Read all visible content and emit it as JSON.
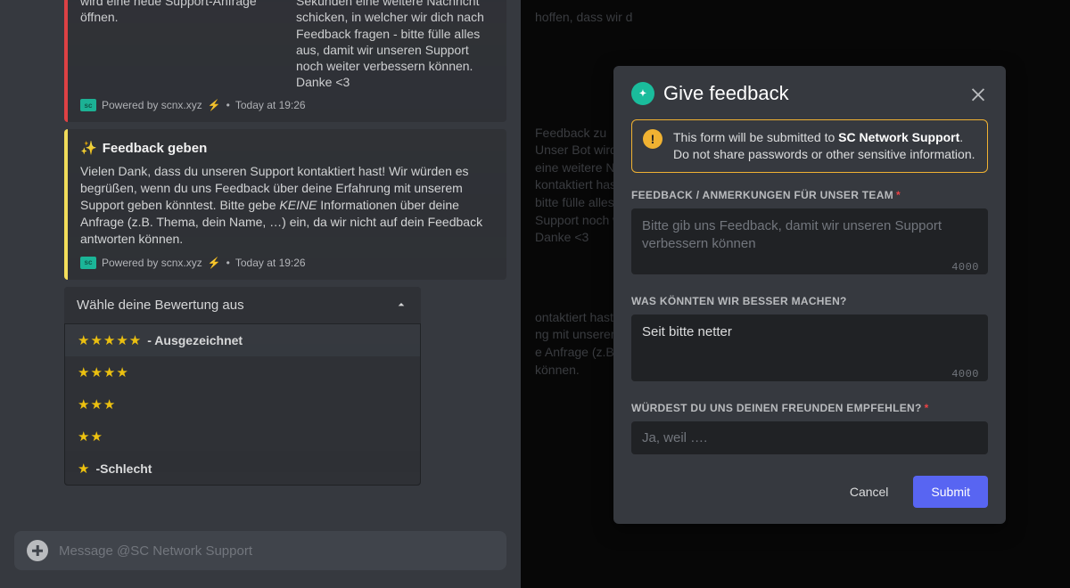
{
  "leftChat": {
    "embed1": {
      "colLeft": "Eine Antwort auf diese Nachricht wird eine neue Support-Anfrage öffnen.",
      "colRight": "Unser Bot wird dir in wenigen Sekunden eine weitere Nachricht schicken, in welcher wir dich nach Feedback fragen - bitte fülle alles aus, damit wir unseren Support noch weiter verbessern können. Danke <3",
      "footer_powered": "Powered by scnx.xyz",
      "footer_time": "Today at 19:26"
    },
    "embed2": {
      "title": "Feedback geben",
      "body_pre": "Vielen Dank, dass du unseren Support kontaktiert hast! Wir würden es begrüßen, wenn du uns Feedback über deine Erfahrung mit unserem Support geben könntest. Bitte gebe ",
      "body_em": "KEINE",
      "body_post": " Informationen über deine Anfrage (z.B. Thema, dein Name, …) ein, da wir nicht auf dein Feedback antworten können.",
      "footer_powered": "Powered by scnx.xyz",
      "footer_time": "Today at 19:26"
    },
    "dropdown": {
      "header": "Wähle deine Bewertung aus",
      "options": [
        {
          "stars": "★★★★★",
          "label": " - Ausgezeichnet"
        },
        {
          "stars": "★★★★",
          "label": ""
        },
        {
          "stars": "★★★",
          "label": ""
        },
        {
          "stars": "★★",
          "label": ""
        },
        {
          "stars": "★",
          "label": " -Schlecht"
        }
      ]
    },
    "messageInput": {
      "placeholder": "Message @SC Network Support"
    }
  },
  "rightGhost": {
    "line1": "hoffen, dass wir d",
    "block1": "Feedback zu\nUnser Bot wird d\neine weitere Na\nkontaktiert hast!\nbitte fülle alles a\nSupport noch w\nDanke <3",
    "block2": "ontaktiert hast! Wi\nng mit unserem S\ne Anfrage (z.B. Th\nkönnen."
  },
  "modal": {
    "title": "Give feedback",
    "warning_pre": "This form will be submitted to ",
    "warning_bold": "SC Network Support",
    "warning_post": ". Do not share passwords or other sensitive information.",
    "field1": {
      "label": "FEEDBACK / ANMERKUNGEN FÜR UNSER TEAM",
      "required": "*",
      "placeholder": "Bitte gib uns Feedback, damit wir unseren Support verbessern können",
      "counter": "4000"
    },
    "field2": {
      "label": "WAS KÖNNTEN WIR BESSER MACHEN?",
      "value": "Seit bitte netter",
      "counter": "4000"
    },
    "field3": {
      "label": "WÜRDEST DU UNS DEINEN FREUNDEN EMPFEHLEN?",
      "required": "*",
      "placeholder": "Ja, weil …."
    },
    "cancel": "Cancel",
    "submit": "Submit"
  }
}
